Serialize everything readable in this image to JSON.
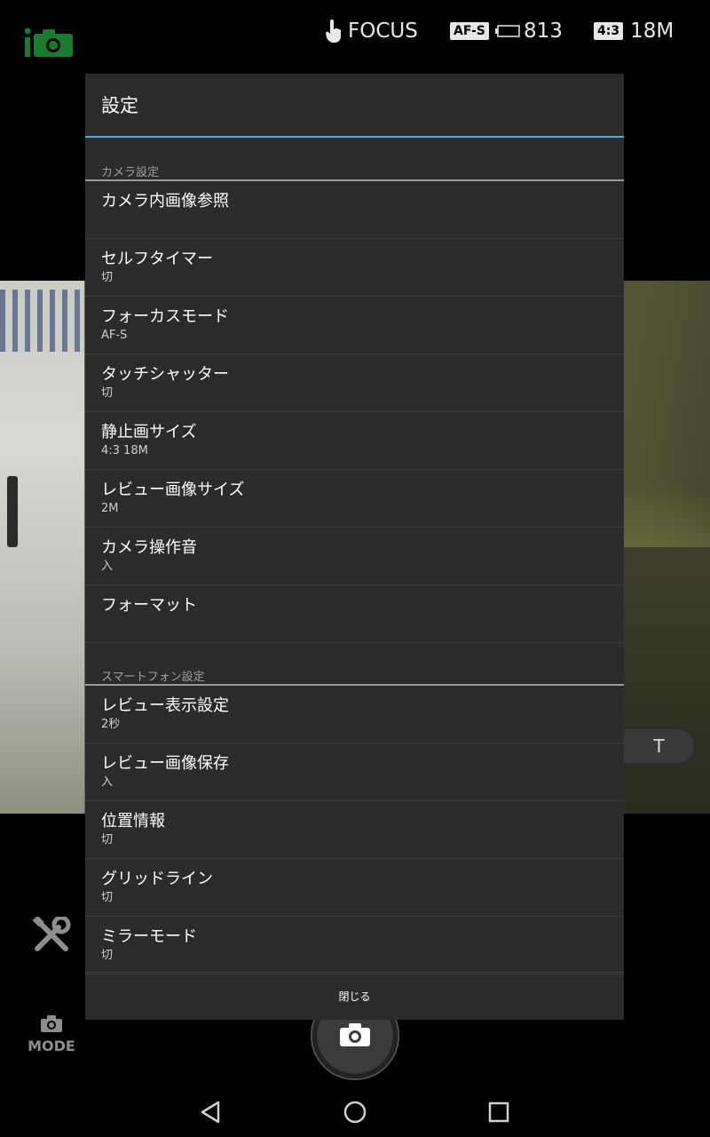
{
  "statusbar": {
    "focus_label": "FOCUS",
    "af_badge": "AF-S",
    "shots_remaining": "813",
    "aspect_badge": "4:3",
    "image_size": "18M"
  },
  "dialog": {
    "title": "設定",
    "sections": [
      {
        "header": "カメラ設定",
        "items": [
          {
            "title": "カメラ内画像参照",
            "value": ""
          },
          {
            "title": "セルフタイマー",
            "value": "切"
          },
          {
            "title": "フォーカスモード",
            "value": "AF-S"
          },
          {
            "title": "タッチシャッター",
            "value": "切"
          },
          {
            "title": "静止画サイズ",
            "value": "4:3 18M"
          },
          {
            "title": "レビュー画像サイズ",
            "value": "2M"
          },
          {
            "title": "カメラ操作音",
            "value": "入"
          },
          {
            "title": "フォーマット",
            "value": ""
          }
        ]
      },
      {
        "header": "スマートフォン設定",
        "items": [
          {
            "title": "レビュー表示設定",
            "value": "2秒"
          },
          {
            "title": "レビュー画像保存",
            "value": "入"
          },
          {
            "title": "位置情報",
            "value": "切"
          },
          {
            "title": "グリッドライン",
            "value": "切"
          },
          {
            "title": "ミラーモード",
            "value": "切"
          }
        ]
      }
    ],
    "close_label": "閉じる"
  },
  "camera_ui": {
    "zoom_tele": "T",
    "mode_label": "MODE"
  },
  "icons": {
    "app_logo": "camera-app-logo-icon",
    "touch": "touch-hand-icon",
    "battery": "battery-icon",
    "tools": "tools-icon",
    "mode": "camera-icon",
    "shutter": "shutter-camera-icon",
    "back": "back-triangle-icon",
    "home": "home-circle-icon",
    "recents": "recents-square-icon"
  },
  "colors": {
    "accent": "#33b5e5",
    "dialog_bg": "#2b2b2b",
    "logo_green": "#1a7a2e"
  }
}
